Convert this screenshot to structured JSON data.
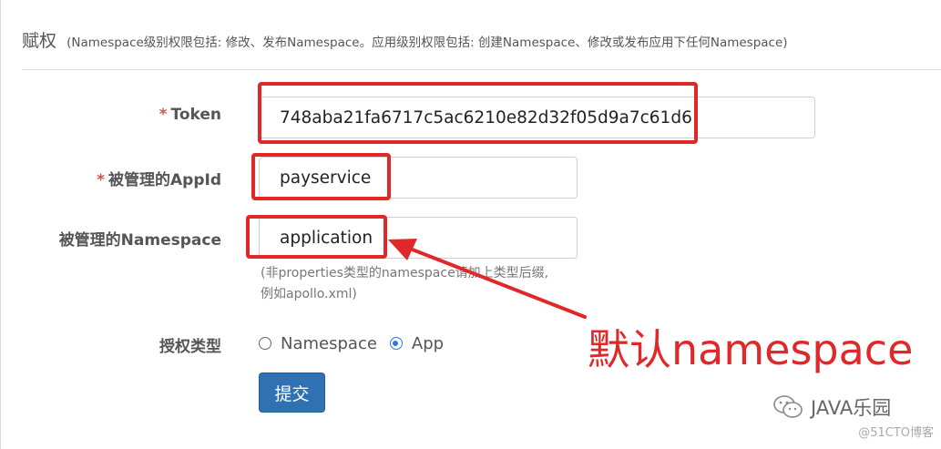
{
  "header": {
    "title": "赋权",
    "description": "(Namespace级别权限包括: 修改、发布Namespace。应用级别权限包括: 创建Namespace、修改或发布应用下任何Namespace)"
  },
  "form": {
    "token": {
      "required_mark": "*",
      "label": "Token",
      "value": "748aba21fa6717c5ac6210e82d32f05d9a7c61d6"
    },
    "appid": {
      "required_mark": "*",
      "label": "被管理的AppId",
      "value": "payservice"
    },
    "namespace": {
      "label": "被管理的Namespace",
      "value": "application",
      "hint_line1": "(非properties类型的namespace请加上类型后缀,",
      "hint_line2": "例如apollo.xml)"
    },
    "auth_type": {
      "label": "授权类型",
      "options": [
        {
          "label": "Namespace",
          "checked": false
        },
        {
          "label": "App",
          "checked": true
        }
      ]
    },
    "submit_label": "提交"
  },
  "annotation": {
    "text": "默认namespace",
    "color": "#e12828"
  },
  "watermark": {
    "brand": "JAVA乐园",
    "credit": "@51CTO博客"
  },
  "colors": {
    "accent": "#3071b3",
    "required": "#d9534f",
    "radio_checked": "#2a7ae2"
  }
}
